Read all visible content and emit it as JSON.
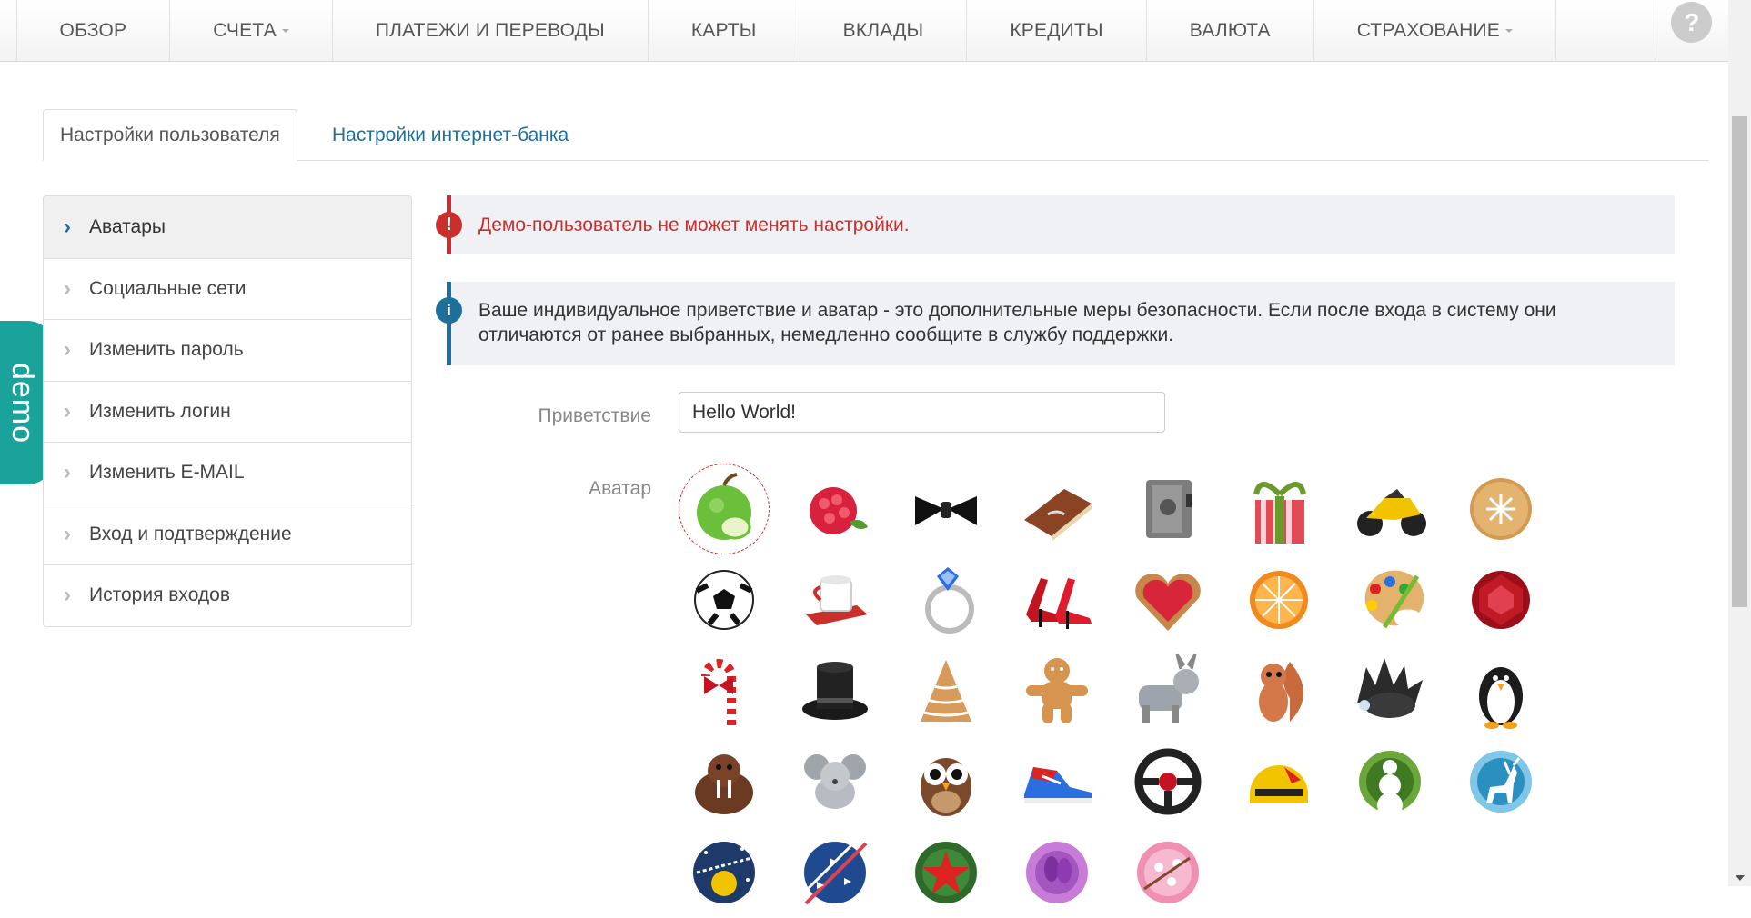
{
  "nav": {
    "items": [
      {
        "label": "ОБЗОР",
        "caret": false
      },
      {
        "label": "СЧЕТА",
        "caret": true
      },
      {
        "label": "ПЛАТЕЖИ И ПЕРЕВОДЫ",
        "caret": false
      },
      {
        "label": "КАРТЫ",
        "caret": false
      },
      {
        "label": "ВКЛАДЫ",
        "caret": false
      },
      {
        "label": "КРЕДИТЫ",
        "caret": false
      },
      {
        "label": "ВАЛЮТА",
        "caret": false
      },
      {
        "label": "СТРАХОВАНИЕ",
        "caret": true
      }
    ],
    "help": "?"
  },
  "tabs": {
    "user_settings": "Настройки пользователя",
    "bank_settings": "Настройки интернет-банка"
  },
  "demo_label": "demo",
  "sidebar": {
    "items": [
      {
        "label": "Аватары",
        "active": true
      },
      {
        "label": "Социальные сети",
        "active": false
      },
      {
        "label": "Изменить пароль",
        "active": false
      },
      {
        "label": "Изменить логин",
        "active": false
      },
      {
        "label": "Изменить E-MAIL",
        "active": false
      },
      {
        "label": "Вход и подтверждение",
        "active": false
      },
      {
        "label": "История входов",
        "active": false
      }
    ]
  },
  "alerts": {
    "error": "Демо-пользователь не может менять настройки.",
    "info": "Ваше индивидуальное приветствие и аватар - это дополнительные меры безопасности. Если после входа в систему они отличаются от ранее выбранных, немедленно сообщите в службу поддержки."
  },
  "form": {
    "greeting_label": "Приветствие",
    "greeting_value": "Hello World!",
    "avatar_label": "Аватар"
  },
  "avatars": [
    {
      "name": "apple",
      "selected": true
    },
    {
      "name": "raspberry"
    },
    {
      "name": "bow-tie"
    },
    {
      "name": "book"
    },
    {
      "name": "safe"
    },
    {
      "name": "gift"
    },
    {
      "name": "motorcycle"
    },
    {
      "name": "cookie"
    },
    {
      "name": "soccer-ball"
    },
    {
      "name": "cup"
    },
    {
      "name": "ring"
    },
    {
      "name": "high-heels"
    },
    {
      "name": "heart-cookie"
    },
    {
      "name": "orange"
    },
    {
      "name": "palette"
    },
    {
      "name": "ruby"
    },
    {
      "name": "candy-cane"
    },
    {
      "name": "top-hat"
    },
    {
      "name": "xmas-tree-cookie"
    },
    {
      "name": "gingerbread-man"
    },
    {
      "name": "donkey"
    },
    {
      "name": "squirrel"
    },
    {
      "name": "hedgehog"
    },
    {
      "name": "penguin"
    },
    {
      "name": "walrus"
    },
    {
      "name": "mouse"
    },
    {
      "name": "owl"
    },
    {
      "name": "sneaker"
    },
    {
      "name": "steering-wheel"
    },
    {
      "name": "helmet"
    },
    {
      "name": "snowman"
    },
    {
      "name": "deer"
    },
    {
      "name": "santa-sleigh"
    },
    {
      "name": "planes"
    },
    {
      "name": "red-star"
    },
    {
      "name": "flowers"
    },
    {
      "name": "sakura"
    }
  ],
  "colors": {
    "accent": "#1f6f9d",
    "error": "#c9302c",
    "demo": "#1aa39a"
  }
}
